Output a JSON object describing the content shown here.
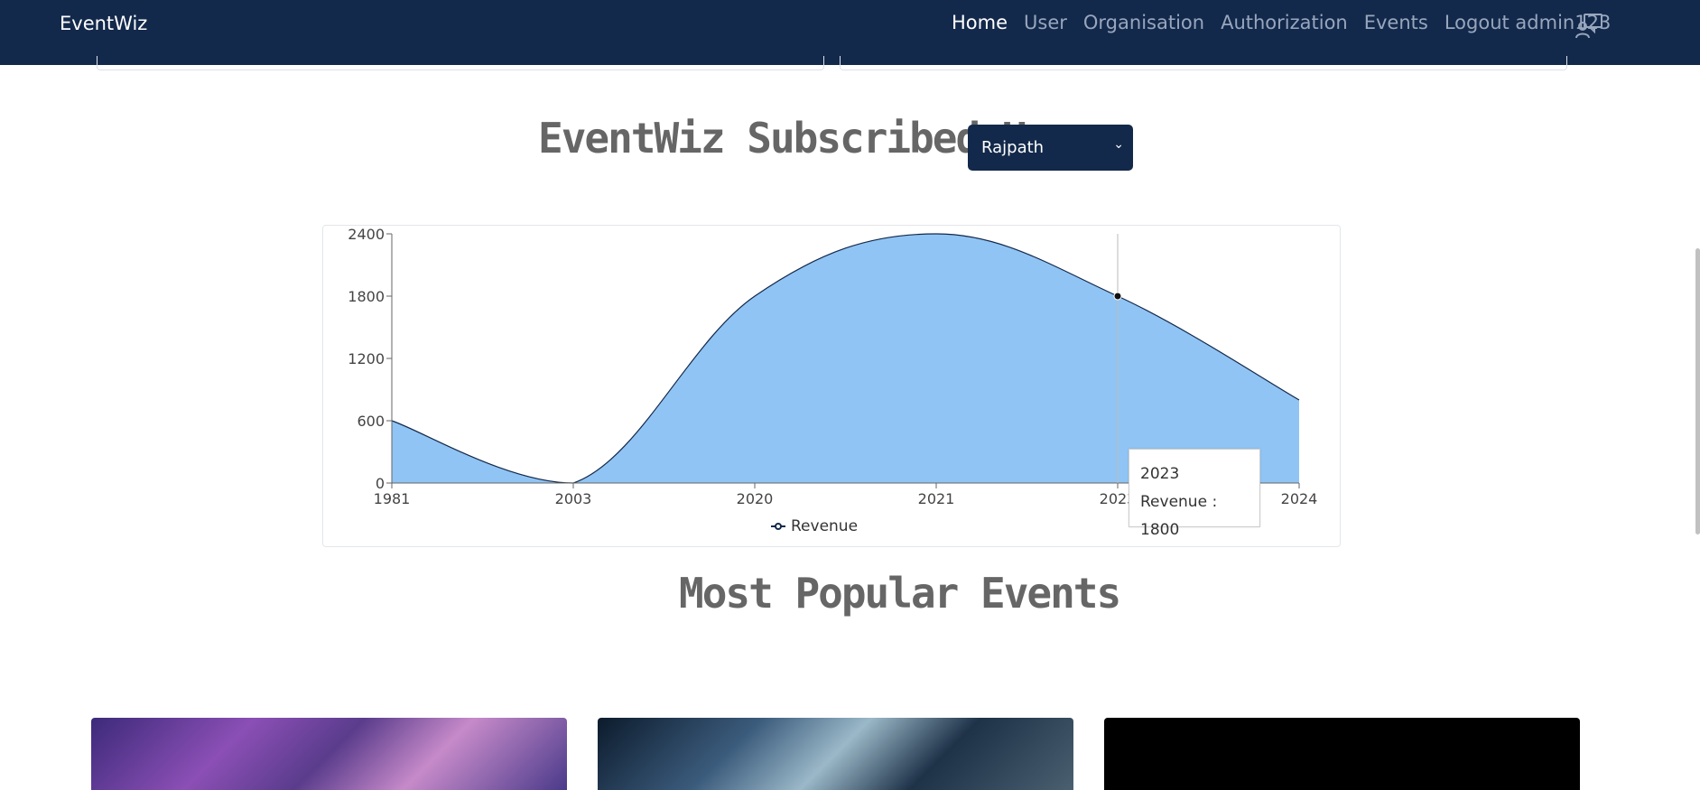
{
  "navbar": {
    "brand": "EventWiz",
    "links": [
      {
        "label": "Home",
        "active": true
      },
      {
        "label": "User",
        "active": false
      },
      {
        "label": "Organisation",
        "active": false
      },
      {
        "label": "Authorization",
        "active": false
      },
      {
        "label": "Events",
        "active": false
      },
      {
        "label": "Logout admin123",
        "active": false
      }
    ],
    "chat_icon": "chat-icon"
  },
  "subscribed": {
    "heading": "EventWiz Subscribed Users",
    "select_value": "Rajpath"
  },
  "chart_data": {
    "type": "area",
    "categories": [
      "1981",
      "2003",
      "2020",
      "2021",
      "2023",
      "2024"
    ],
    "series": [
      {
        "name": "Revenue",
        "values": [
          600,
          0,
          1800,
          2400,
          1800,
          800
        ]
      }
    ],
    "ylim": [
      0,
      2400
    ],
    "yticks": [
      0,
      600,
      1200,
      1800,
      2400
    ],
    "color": "#90c4f4",
    "tooltip": {
      "category": "2023",
      "label": "Revenue : 1800"
    },
    "legend": "Revenue"
  },
  "popular": {
    "heading": "Most Popular Events"
  }
}
